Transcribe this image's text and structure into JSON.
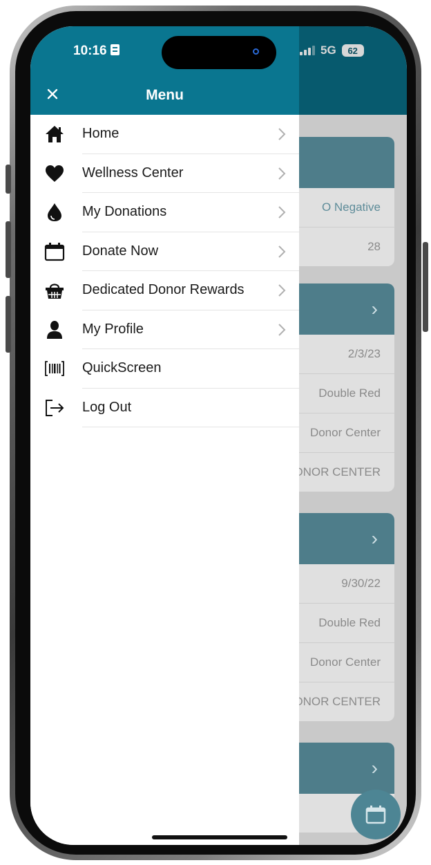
{
  "status_bar": {
    "time": "10:16",
    "network": "5G",
    "battery": "62"
  },
  "drawer": {
    "title": "Menu",
    "items": [
      {
        "label": "Home",
        "icon": "home-icon",
        "chevron": true
      },
      {
        "label": "Wellness Center",
        "icon": "heart-icon",
        "chevron": true
      },
      {
        "label": "My Donations",
        "icon": "blood-drop-icon",
        "chevron": true
      },
      {
        "label": "Donate Now",
        "icon": "calendar-icon",
        "chevron": true
      },
      {
        "label": "Dedicated Donor Rewards",
        "icon": "basket-icon",
        "chevron": true
      },
      {
        "label": "My Profile",
        "icon": "person-icon",
        "chevron": true
      },
      {
        "label": "QuickScreen",
        "icon": "barcode-scan-icon",
        "chevron": false
      },
      {
        "label": "Log Out",
        "icon": "logout-icon",
        "chevron": false
      }
    ]
  },
  "background": {
    "blood_type": "O Negative",
    "count": "28",
    "donations": [
      {
        "date": "2/3/23",
        "type": "Double Red",
        "location": "Donor Center",
        "center": "DNOR CENTER"
      },
      {
        "date": "9/30/22",
        "type": "Double Red",
        "location": "Donor Center",
        "center": "DNOR CENTER"
      }
    ]
  },
  "colors": {
    "header": "#0a7690",
    "overlay_header": "#075a6e",
    "card_header": "#4e7d8a"
  }
}
